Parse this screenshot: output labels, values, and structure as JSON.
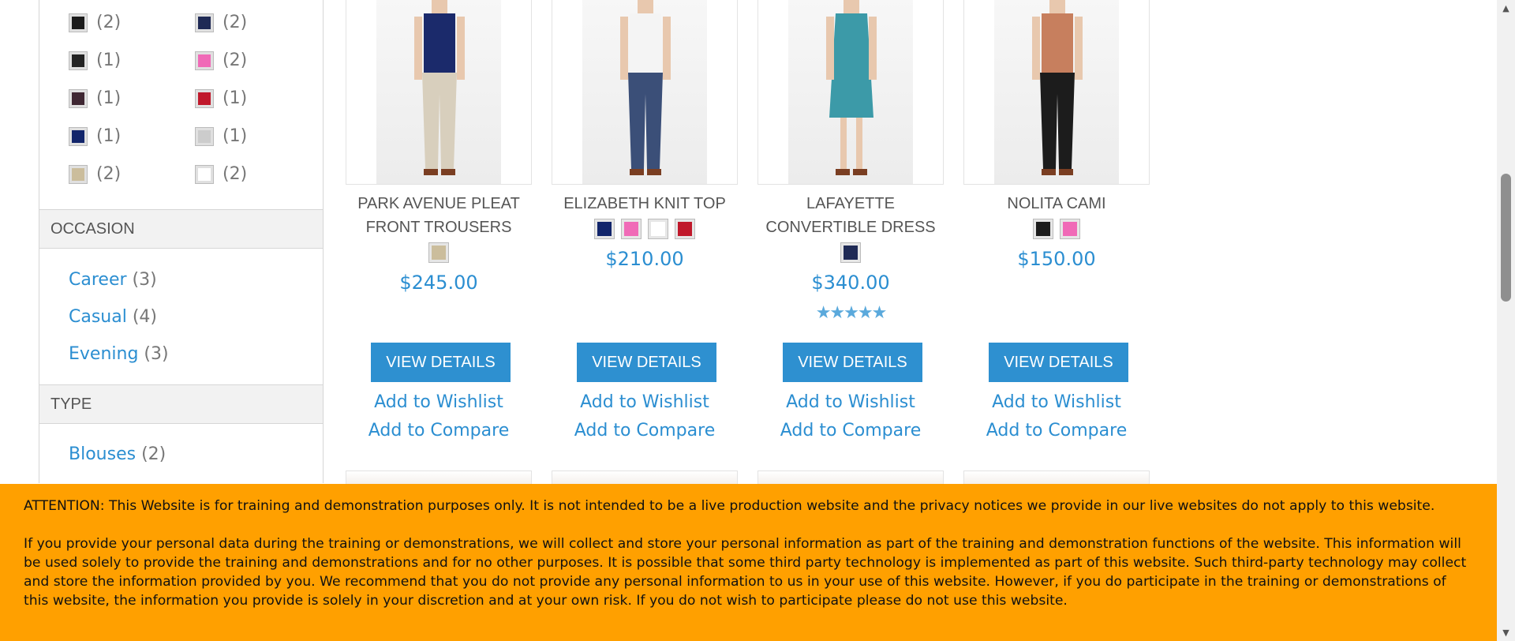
{
  "sidebar": {
    "color_swatches": [
      {
        "color": "#1c1c1c",
        "count": "(2)"
      },
      {
        "color": "#1f2a55",
        "count": "(2)"
      },
      {
        "color": "#232323",
        "count": "(1)"
      },
      {
        "color": "#f06ab7",
        "count": "(2)"
      },
      {
        "color": "#3f2733",
        "count": "(1)"
      },
      {
        "color": "#c0182b",
        "count": "(1)"
      },
      {
        "color": "#12256b",
        "count": "(1)"
      },
      {
        "color": "#cccccc",
        "count": "(1)"
      },
      {
        "color": "#cbbd9c",
        "count": "(2)"
      },
      {
        "color": "#ffffff",
        "count": "(2)"
      }
    ],
    "occasion": {
      "title": "OCCASION",
      "items": [
        {
          "label": "Career",
          "count": "(3)"
        },
        {
          "label": "Casual",
          "count": "(4)"
        },
        {
          "label": "Evening",
          "count": "(3)"
        }
      ]
    },
    "type": {
      "title": "TYPE",
      "items": [
        {
          "label": "Blouses",
          "count": "(2)"
        }
      ]
    }
  },
  "products": [
    {
      "name_lines": [
        "PARK AVENUE PLEAT",
        "FRONT TROUSERS"
      ],
      "swatches": [
        "#cbbd9c"
      ],
      "price": "$245.00",
      "rating": "",
      "button": "VIEW DETAILS",
      "wishlist": "Add to Wishlist",
      "compare": "Add to Compare"
    },
    {
      "name_lines": [
        "ELIZABETH KNIT TOP"
      ],
      "swatches": [
        "#12256b",
        "#f06ab7",
        "#ffffff",
        "#c0182b"
      ],
      "price": "$210.00",
      "rating": "",
      "button": "VIEW DETAILS",
      "wishlist": "Add to Wishlist",
      "compare": "Add to Compare"
    },
    {
      "name_lines": [
        "LAFAYETTE",
        "CONVERTIBLE DRESS"
      ],
      "swatches": [
        "#1f2a55"
      ],
      "price": "$340.00",
      "rating": "★★★★★",
      "button": "VIEW DETAILS",
      "wishlist": "Add to Wishlist",
      "compare": "Add to Compare"
    },
    {
      "name_lines": [
        "NOLITA CAMI"
      ],
      "swatches": [
        "#1c1c1c",
        "#f06ab7"
      ],
      "price": "$150.00",
      "rating": "",
      "button": "VIEW DETAILS",
      "wishlist": "Add to Wishlist",
      "compare": "Add to Compare"
    }
  ],
  "notice": {
    "paragraph1": "ATTENTION: This Website is for training and demonstration purposes only. It is not intended to be a live production website and the privacy notices we provide in our live websites do not apply to this website.",
    "paragraph2": "If you provide your personal data during the training or demonstrations, we will collect and store your personal information as part of the training and demonstration functions of the website. This information will be used solely to provide the training and demonstrations and for no other purposes. It is possible that some third party technology is implemented as part of this website. Such third-party technology may collect and store the information provided by you. We recommend that you do not provide any personal information to us in your use of this website. However, if you do participate in the training or demonstrations of this website, the information you provide is solely in your discretion and at your own risk. If you do not wish to participate please do not use this website."
  }
}
